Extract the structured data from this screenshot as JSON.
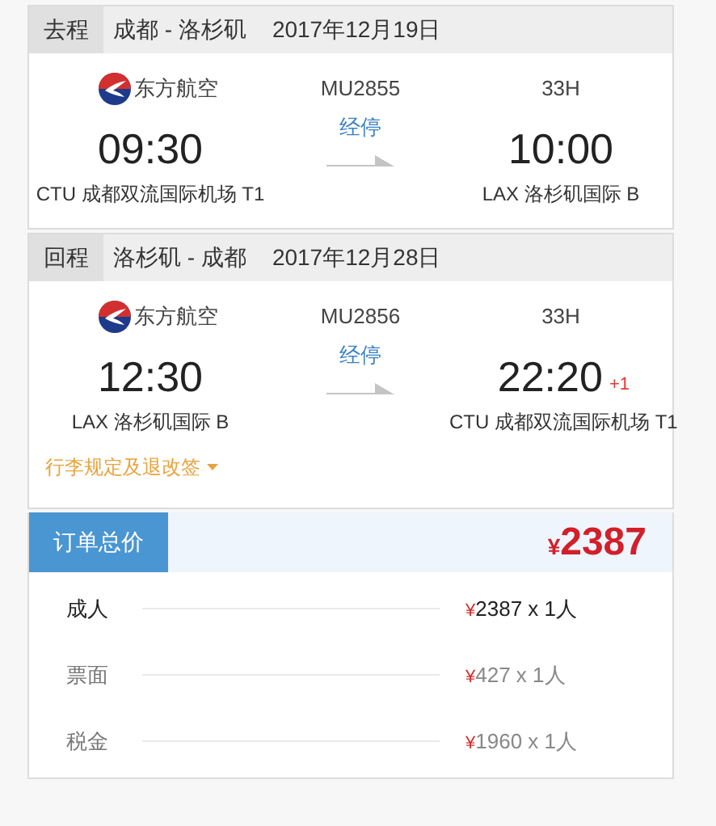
{
  "legs": [
    {
      "direction": "去程",
      "route": "成都 - 洛杉矶",
      "date": "2017年12月19日",
      "airline": "东方航空",
      "flight_no": "MU2855",
      "aircraft": "33H",
      "departure_time": "09:30",
      "stop": "经停",
      "arrival_time": "10:00",
      "departure_airport": "CTU 成都双流国际机场 T1",
      "arrival_airport": "LAX 洛杉矶国际 B"
    },
    {
      "direction": "回程",
      "route": "洛杉矶 - 成都",
      "date": "2017年12月28日",
      "airline": "东方航空",
      "flight_no": "MU2856",
      "aircraft": "33H",
      "departure_time": "12:30",
      "stop": "经停",
      "arrival_time": "22:20",
      "day_offset": "+1",
      "departure_airport": "LAX 洛杉矶国际 B",
      "arrival_airport": "CTU 成都双流国际机场 T1"
    }
  ],
  "baggage_link": "行李规定及退改签",
  "order_total": {
    "label": "订单总价",
    "currency": "¥",
    "amount": "2387"
  },
  "price_rows": [
    {
      "kind": "passenger",
      "label": "成人",
      "currency": "¥",
      "amount": "2387 x 1人"
    },
    {
      "kind": "component",
      "label": "票面",
      "currency": "¥",
      "amount": "427 x 1人"
    },
    {
      "kind": "component",
      "label": "税金",
      "currency": "¥",
      "amount": "1960 x 1人"
    }
  ]
}
